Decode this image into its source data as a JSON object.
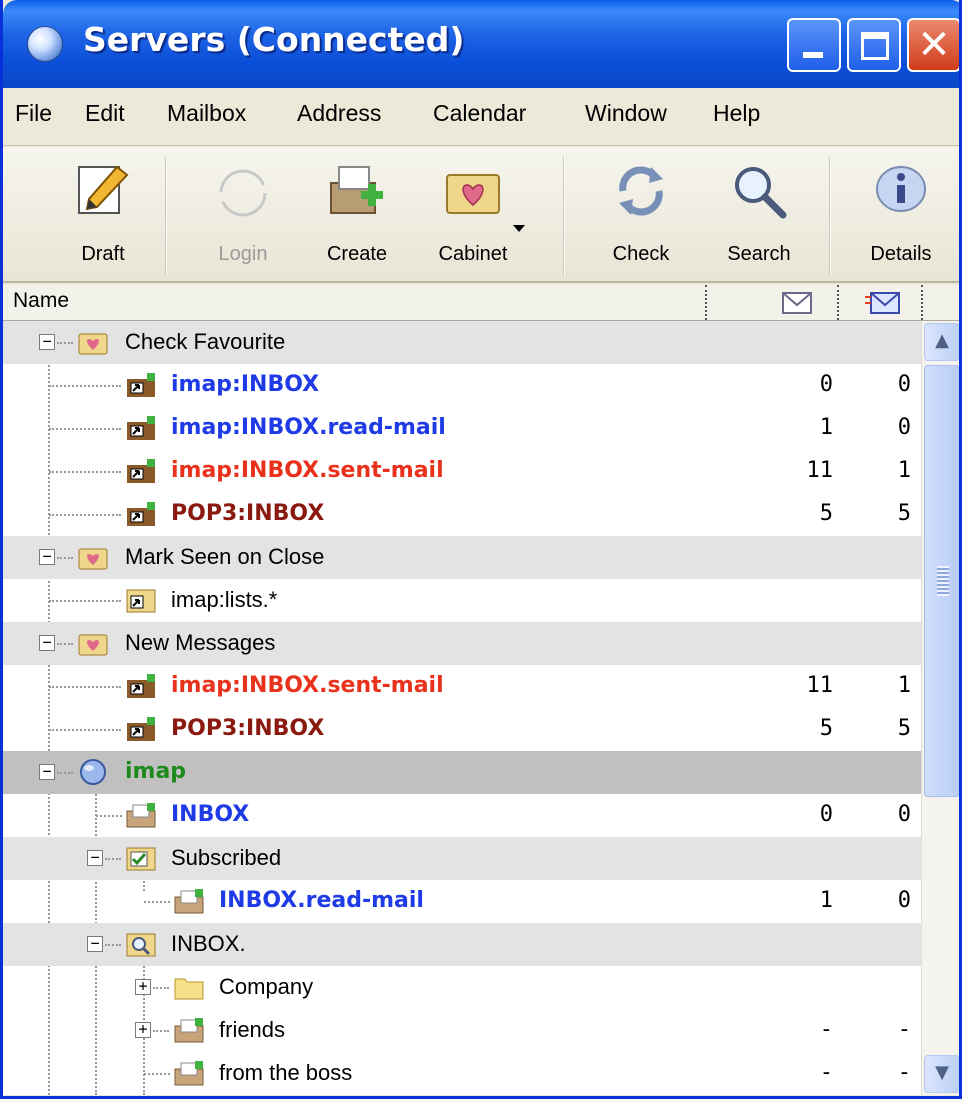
{
  "window": {
    "title": "Servers (Connected)"
  },
  "menu": [
    "File",
    "Edit",
    "Mailbox",
    "Address",
    "Calendar",
    "Window",
    "Help"
  ],
  "toolbar": {
    "draft": "Draft",
    "login": "Login",
    "create": "Create",
    "cabinet": "Cabinet",
    "check": "Check",
    "search": "Search",
    "details": "Details"
  },
  "header": {
    "name": "Name"
  },
  "tree": {
    "check_favourite": "Check Favourite",
    "cf_inbox": {
      "label": "imap:INBOX",
      "total": "0",
      "new": "0"
    },
    "cf_read": {
      "label": "imap:INBOX.read-mail",
      "total": "1",
      "new": "0"
    },
    "cf_sent": {
      "label": "imap:INBOX.sent-mail",
      "total": "11",
      "new": "1"
    },
    "cf_pop": {
      "label": "POP3:INBOX",
      "total": "5",
      "new": "5"
    },
    "mark_seen": "Mark Seen on Close",
    "ms_lists": "imap:lists.*",
    "new_messages": "New Messages",
    "nm_sent": {
      "label": "imap:INBOX.sent-mail",
      "total": "11",
      "new": "1"
    },
    "nm_pop": {
      "label": "POP3:INBOX",
      "total": "5",
      "new": "5"
    },
    "imap": "imap",
    "imap_inbox": {
      "label": "INBOX",
      "total": "0",
      "new": "0"
    },
    "subscribed": "Subscribed",
    "sub_read": {
      "label": "INBOX.read-mail",
      "total": "1",
      "new": "0"
    },
    "inbox_dot": "INBOX.",
    "company": "Company",
    "friends": {
      "label": "friends",
      "total": "-",
      "new": "-"
    },
    "boss": {
      "label": "from the boss",
      "total": "-",
      "new": "-"
    }
  },
  "colors": {
    "blue": "#1f3be6",
    "red": "#e8321c",
    "darkred": "#8a1a10",
    "green": "#1e8a1e"
  }
}
